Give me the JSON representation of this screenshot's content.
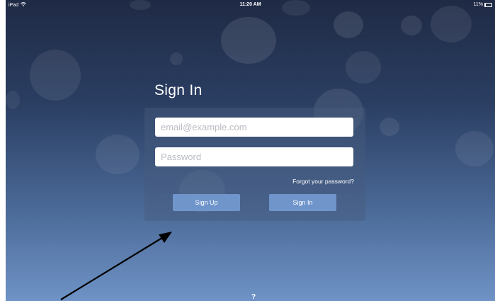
{
  "status_bar": {
    "device": "iPad",
    "wifi_icon": "wifi-icon",
    "time": "11:20 AM",
    "battery_percent": "11%",
    "battery_level": 0.11
  },
  "signin_form": {
    "title": "Sign In",
    "email_placeholder": "email@example.com",
    "password_placeholder": "Password",
    "forgot_link": "Forgot your password?",
    "signup_button": "Sign Up",
    "signin_button": "Sign In"
  },
  "colors": {
    "background_top": "#1f2a45",
    "background_bottom": "#6f93c6",
    "button": "#6f95cb",
    "annotation_arrow": "#000000"
  },
  "annotation": {
    "arrow_icon": "arrow-icon"
  },
  "page_indicator": "?"
}
